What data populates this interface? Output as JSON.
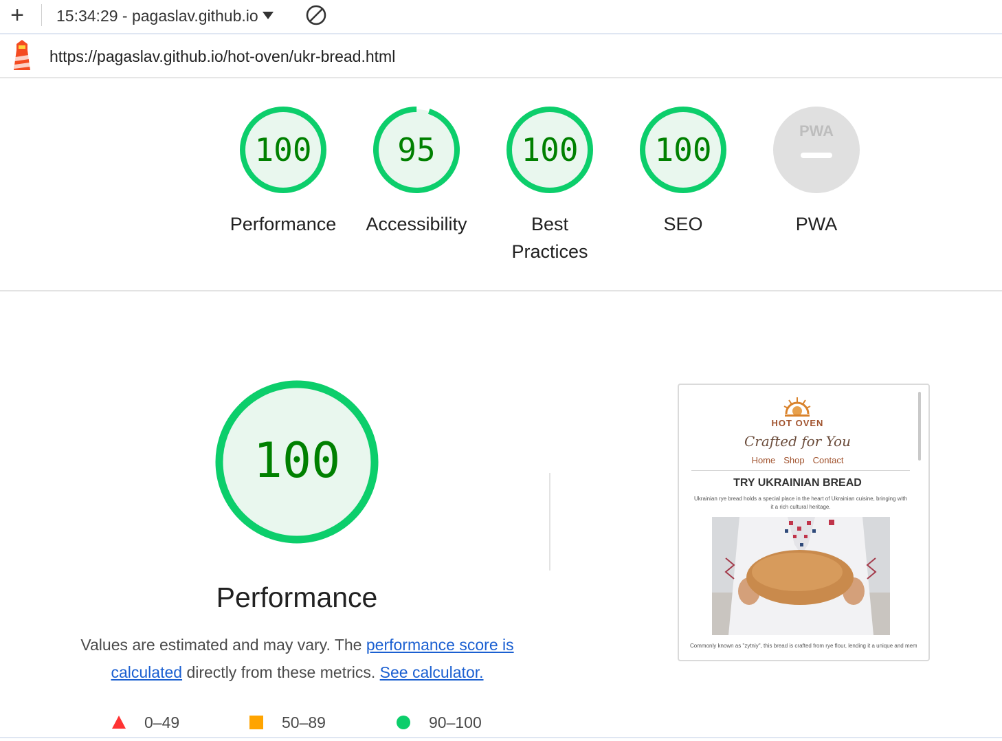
{
  "toolbar": {
    "report_label": "15:34:29 - pagaslav.github.io",
    "plus_icon": "plus-icon",
    "clear_icon": "block-icon"
  },
  "url_bar": {
    "logo_icon": "lighthouse-icon",
    "url": "https://pagaslav.github.io/hot-oven/ukr-bread.html"
  },
  "colors": {
    "pass": "#0cce6b",
    "pass_text": "#008000",
    "pass_fill": "#e9f7ee",
    "average": "#ffa400",
    "fail": "#ff3333",
    "na": "#e0e0e0",
    "link": "#1a5fd1"
  },
  "categories": [
    {
      "label": "Performance",
      "score": "100",
      "value": 100
    },
    {
      "label": "Accessibility",
      "score": "95",
      "value": 95
    },
    {
      "label": "Best Practices",
      "score": "100",
      "value": 100
    },
    {
      "label": "SEO",
      "score": "100",
      "value": 100
    },
    {
      "label": "PWA",
      "score": "",
      "value": null,
      "badge": "PWA"
    }
  ],
  "performance": {
    "score": "100",
    "value": 100,
    "title": "Performance",
    "desc_prefix": "Values are estimated and may vary. The ",
    "desc_link1": "performance score is calculated",
    "desc_middle": " directly from these metrics. ",
    "desc_link2": "See calculator."
  },
  "screenshot": {
    "brand": "HOT OVEN",
    "tagline": "Crafted for You",
    "nav": [
      "Home",
      "Shop",
      "Contact"
    ],
    "heading": "TRY UKRAINIAN BREAD",
    "para1": "Ukrainian rye bread holds a special place in the heart of Ukrainian cuisine, bringing with it a rich cultural heritage.",
    "para2": "Commonly known as \"zytniy\", this bread is crafted from rye flour, lending it a unique and memorable taste."
  },
  "legend": [
    {
      "range": "0–49",
      "shape": "triangle",
      "color": "#ff3333"
    },
    {
      "range": "50–89",
      "shape": "square",
      "color": "#ffa400"
    },
    {
      "range": "90–100",
      "shape": "circle",
      "color": "#0cce6b"
    }
  ]
}
